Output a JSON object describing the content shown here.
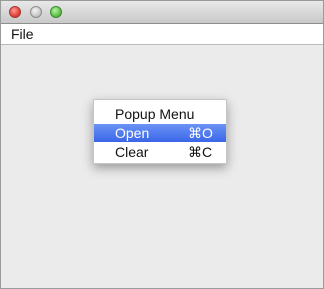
{
  "window": {
    "controls": [
      "close-icon",
      "minimize-icon",
      "maximize-icon"
    ]
  },
  "menubar": {
    "file_label": "File"
  },
  "popup": {
    "title": "Popup Menu",
    "items": [
      {
        "label": "Open",
        "shortcut": "⌘O",
        "highlighted": true
      },
      {
        "label": "Clear",
        "shortcut": "⌘C",
        "highlighted": false
      }
    ]
  },
  "colors": {
    "highlight": "#3a66e8",
    "close": "#e0443a",
    "maximize": "#5fc44a"
  }
}
